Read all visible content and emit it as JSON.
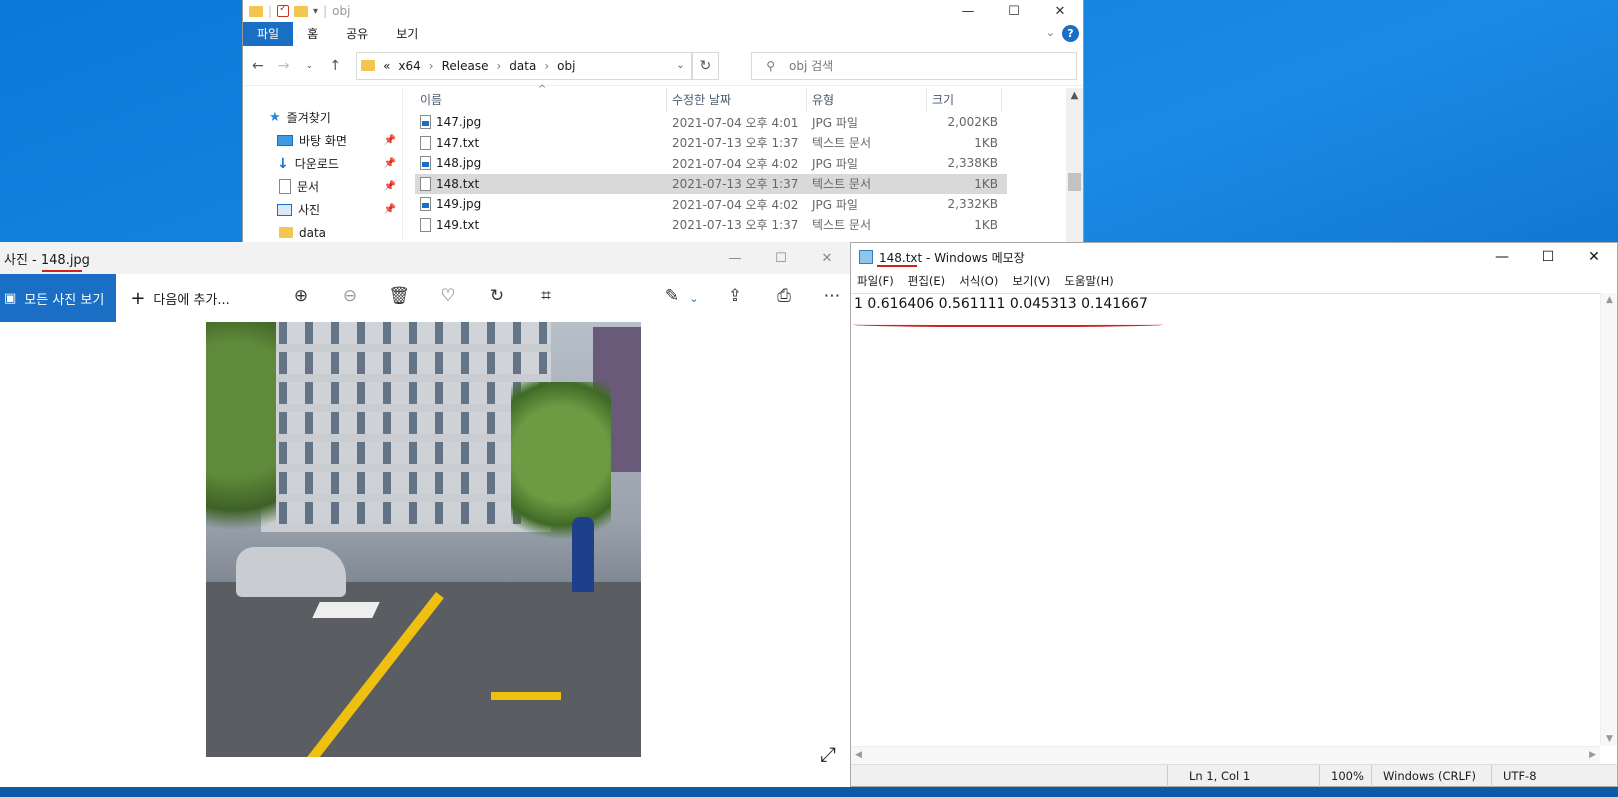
{
  "explorer": {
    "title": "obj",
    "ribbon_tabs": [
      "파일",
      "홈",
      "공유",
      "보기"
    ],
    "breadcrumb": [
      "x64",
      "Release",
      "data",
      "obj"
    ],
    "breadcrumb_prefix": "«",
    "search_placeholder": "obj 검색",
    "nav": [
      {
        "label": "즐겨찾기",
        "icon": "star-icon"
      },
      {
        "label": "바탕 화면",
        "icon": "desktop-icon",
        "pinned": true
      },
      {
        "label": "다운로드",
        "icon": "download-icon",
        "pinned": true
      },
      {
        "label": "문서",
        "icon": "document-icon",
        "pinned": true
      },
      {
        "label": "사진",
        "icon": "pictures-icon",
        "pinned": true
      },
      {
        "label": "data",
        "icon": "folder-icon"
      }
    ],
    "columns": [
      "이름",
      "수정한 날짜",
      "유형",
      "크기"
    ],
    "files": [
      {
        "name": "147.jpg",
        "date": "2021-07-04 오후 4:01",
        "type": "JPG 파일",
        "size": "2,002KB",
        "kind": "jpg"
      },
      {
        "name": "147.txt",
        "date": "2021-07-13 오후 1:37",
        "type": "텍스트 문서",
        "size": "1KB",
        "kind": "txt"
      },
      {
        "name": "148.jpg",
        "date": "2021-07-04 오후 4:02",
        "type": "JPG 파일",
        "size": "2,338KB",
        "kind": "jpg"
      },
      {
        "name": "148.txt",
        "date": "2021-07-13 오후 1:37",
        "type": "텍스트 문서",
        "size": "1KB",
        "kind": "txt",
        "selected": true
      },
      {
        "name": "149.jpg",
        "date": "2021-07-04 오후 4:02",
        "type": "JPG 파일",
        "size": "2,332KB",
        "kind": "jpg"
      },
      {
        "name": "149.txt",
        "date": "2021-07-13 오후 1:37",
        "type": "텍스트 문서",
        "size": "1KB",
        "kind": "txt"
      }
    ]
  },
  "photos": {
    "title": "사진 - 148.jpg",
    "all_photos_label": "모든 사진 보기",
    "add_to_label": "다음에 추가...",
    "toolbar_icons": [
      "zoom-in-icon",
      "zoom-out-icon",
      "delete-icon",
      "favorite-icon",
      "rotate-icon",
      "crop-icon",
      "edit-icon",
      "share-icon",
      "print-icon",
      "more-icon"
    ]
  },
  "notepad": {
    "title": "148.txt - Windows 메모장",
    "menu": [
      "파일(F)",
      "편집(E)",
      "서식(O)",
      "보기(V)",
      "도움말(H)"
    ],
    "content": "1 0.616406 0.561111 0.045313 0.141667",
    "status": {
      "position": "Ln 1, Col 1",
      "zoom": "100%",
      "line_ending": "Windows (CRLF)",
      "encoding": "UTF-8"
    }
  }
}
